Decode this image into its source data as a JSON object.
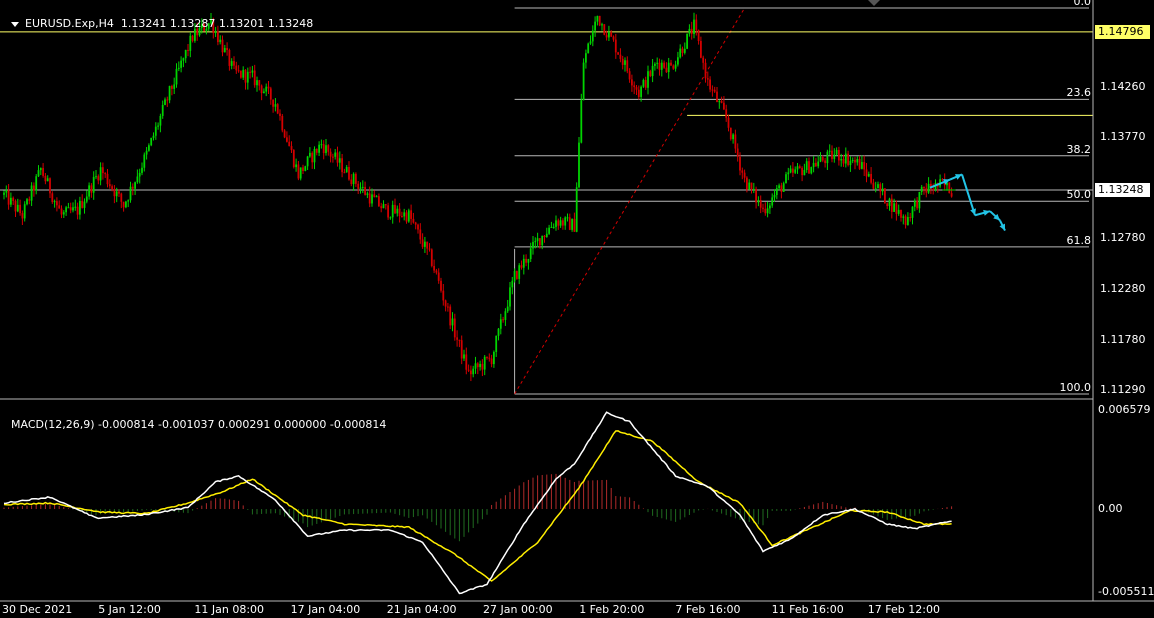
{
  "symbol_header": {
    "menu_icon": "triangle-down-icon",
    "text": "EURUSD.Exp,H4  1.13241 1.13287 1.13201 1.13248"
  },
  "macd_header": {
    "text": "MACD(12,26,9) -0.000814 -0.001037 0.000291 0.000000 -0.000814"
  },
  "price_axis": {
    "labels": [
      "1.14260",
      "1.13770",
      "1.12780",
      "1.12280",
      "1.11780",
      "1.11290"
    ],
    "current_price": "1.13248",
    "line_price": "1.14796"
  },
  "macd_axis": {
    "labels": [
      "0.006579",
      "0.00",
      "-0.005511"
    ]
  },
  "fibonacci": {
    "levels": [
      "0.0",
      "23.6",
      "38.2",
      "50.0",
      "61.8",
      "100.0"
    ]
  },
  "time_axis": {
    "labels": [
      "30 Dec 2021",
      "5 Jan 12:00",
      "11 Jan 08:00",
      "17 Jan 04:00",
      "21 Jan 04:00",
      "27 Jan 00:00",
      "1 Feb 20:00",
      "7 Feb 16:00",
      "11 Feb 16:00",
      "17 Feb 12:00"
    ]
  },
  "chart_data": {
    "type": "candlestick",
    "symbol": "EURUSD.Exp",
    "timeframe": "H4",
    "price_range": [
      1.1123,
      1.1503
    ],
    "horizontal_lines": [
      1.14796,
      1.13978,
      1.13248
    ],
    "fibonacci_prices": {
      "0.0": 1.1503,
      "23.6": 1.14135,
      "38.2": 1.13583,
      "50.0": 1.13137,
      "61.8": 1.12691,
      "100.0": 1.1125
    },
    "close_anchors": [
      [
        0,
        1.132
      ],
      [
        8,
        1.13
      ],
      [
        16,
        1.1345
      ],
      [
        25,
        1.13
      ],
      [
        32,
        1.1305
      ],
      [
        42,
        1.1345
      ],
      [
        52,
        1.131
      ],
      [
        62,
        1.136
      ],
      [
        72,
        1.142
      ],
      [
        82,
        1.1475
      ],
      [
        90,
        1.149
      ],
      [
        100,
        1.144
      ],
      [
        108,
        1.1435
      ],
      [
        118,
        1.141
      ],
      [
        128,
        1.134
      ],
      [
        138,
        1.137
      ],
      [
        148,
        1.1345
      ],
      [
        158,
        1.132
      ],
      [
        166,
        1.1305
      ],
      [
        176,
        1.13
      ],
      [
        186,
        1.1255
      ],
      [
        196,
        1.1185
      ],
      [
        202,
        1.1145
      ],
      [
        212,
        1.116
      ],
      [
        222,
        1.124
      ],
      [
        232,
        1.1275
      ],
      [
        240,
        1.1295
      ],
      [
        248,
        1.129
      ],
      [
        252,
        1.145
      ],
      [
        258,
        1.1495
      ],
      [
        266,
        1.1465
      ],
      [
        276,
        1.142
      ],
      [
        284,
        1.145
      ],
      [
        290,
        1.1445
      ],
      [
        300,
        1.1485
      ],
      [
        306,
        1.143
      ],
      [
        314,
        1.1395
      ],
      [
        322,
        1.1335
      ],
      [
        330,
        1.1305
      ],
      [
        342,
        1.134
      ],
      [
        352,
        1.135
      ],
      [
        362,
        1.136
      ],
      [
        372,
        1.135
      ],
      [
        382,
        1.132
      ],
      [
        392,
        1.1295
      ],
      [
        400,
        1.1325
      ],
      [
        408,
        1.133
      ],
      [
        412,
        1.13248
      ]
    ],
    "projection": [
      [
        930,
        1.1327
      ],
      [
        950,
        1.1335
      ],
      [
        962,
        1.134
      ],
      [
        975,
        1.13
      ],
      [
        990,
        1.1304
      ],
      [
        1000,
        1.1295
      ],
      [
        1005,
        1.1285
      ]
    ],
    "macd": {
      "range": [
        -0.005511,
        0.006579
      ],
      "main_anchors": [
        [
          0,
          0.0004
        ],
        [
          20,
          0.0008
        ],
        [
          40,
          -0.0006
        ],
        [
          60,
          -0.0004
        ],
        [
          80,
          0.0001
        ],
        [
          92,
          0.0018
        ],
        [
          102,
          0.0022
        ],
        [
          118,
          0.0006
        ],
        [
          132,
          -0.0018
        ],
        [
          148,
          -0.0014
        ],
        [
          168,
          -0.0014
        ],
        [
          182,
          -0.0022
        ],
        [
          198,
          -0.0056
        ],
        [
          210,
          -0.005
        ],
        [
          226,
          -0.001
        ],
        [
          240,
          0.002
        ],
        [
          248,
          0.003
        ],
        [
          262,
          0.0064
        ],
        [
          272,
          0.0058
        ],
        [
          292,
          0.0022
        ],
        [
          306,
          0.0015
        ],
        [
          320,
          -0.0004
        ],
        [
          330,
          -0.0028
        ],
        [
          342,
          -0.002
        ],
        [
          356,
          -0.0004
        ],
        [
          370,
          0.0
        ],
        [
          384,
          -0.001
        ],
        [
          396,
          -0.0013
        ],
        [
          412,
          -0.0008
        ]
      ],
      "signal_anchors": [
        [
          0,
          0.0003
        ],
        [
          20,
          0.0004
        ],
        [
          42,
          -0.0002
        ],
        [
          62,
          -0.0003
        ],
        [
          80,
          0.0004
        ],
        [
          96,
          0.0012
        ],
        [
          108,
          0.002
        ],
        [
          130,
          -0.0004
        ],
        [
          148,
          -0.001
        ],
        [
          176,
          -0.0012
        ],
        [
          196,
          -0.003
        ],
        [
          212,
          -0.0048
        ],
        [
          232,
          -0.0022
        ],
        [
          250,
          0.0014
        ],
        [
          266,
          0.0052
        ],
        [
          282,
          0.0045
        ],
        [
          302,
          0.0018
        ],
        [
          320,
          0.0004
        ],
        [
          334,
          -0.0024
        ],
        [
          352,
          -0.0012
        ],
        [
          368,
          -0.0001
        ],
        [
          384,
          -0.0002
        ],
        [
          400,
          -0.001
        ],
        [
          412,
          -0.001
        ]
      ]
    }
  },
  "colors": {
    "background": "#000000",
    "bull": "#00d400",
    "bear": "#d40000",
    "grid_line": "#b8b8b8",
    "yellow_line": "#ffff66",
    "projection": "#22c4e6",
    "macd_main": "#ffffff",
    "macd_signal": "#ffee00",
    "hist_pos": "#b02a2a",
    "hist_neg": "#1f6b1f"
  }
}
